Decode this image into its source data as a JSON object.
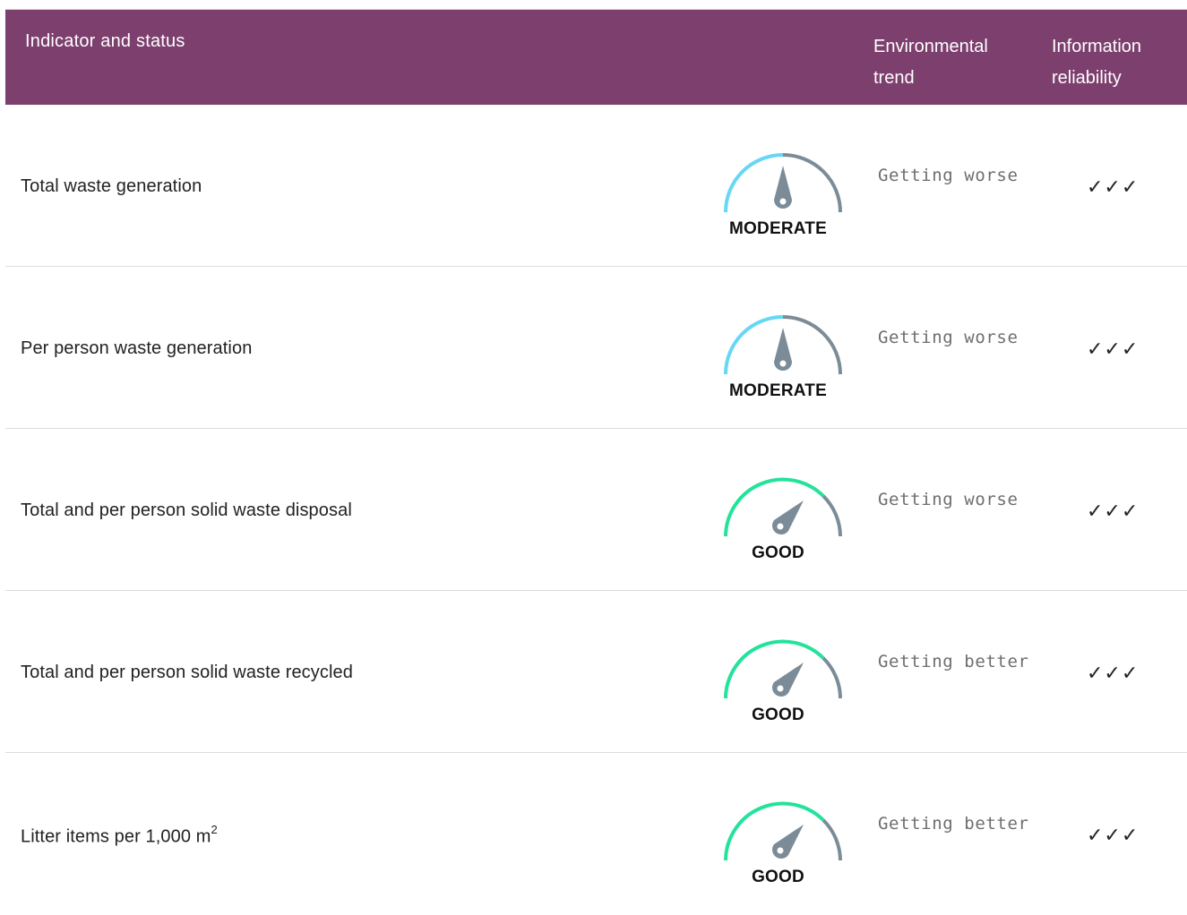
{
  "header": {
    "indicator": "Indicator and status",
    "trend": "Environmental trend",
    "reliability": "Information reliability"
  },
  "colors": {
    "header_bg": "#7d3f6e",
    "moderate_arc": "#66d7f5",
    "good_arc": "#22e39a",
    "gauge_grey": "#7b8c98"
  },
  "rows": [
    {
      "name": "Total waste generation",
      "status": "MODERATE",
      "trend": "Getting worse",
      "reliability": "✓✓✓"
    },
    {
      "name": "Per person waste generation",
      "status": "MODERATE",
      "trend": "Getting worse",
      "reliability": "✓✓✓"
    },
    {
      "name": "Total and per person solid waste disposal",
      "status": "GOOD",
      "trend": "Getting worse",
      "reliability": "✓✓✓"
    },
    {
      "name": "Total and per person solid waste recycled",
      "status": "GOOD",
      "trend": "Getting better",
      "reliability": "✓✓✓"
    },
    {
      "name": "Litter items per 1,000 m",
      "name_sup": "2",
      "status": "GOOD",
      "trend": "Getting better",
      "reliability": "✓✓✓"
    }
  ]
}
